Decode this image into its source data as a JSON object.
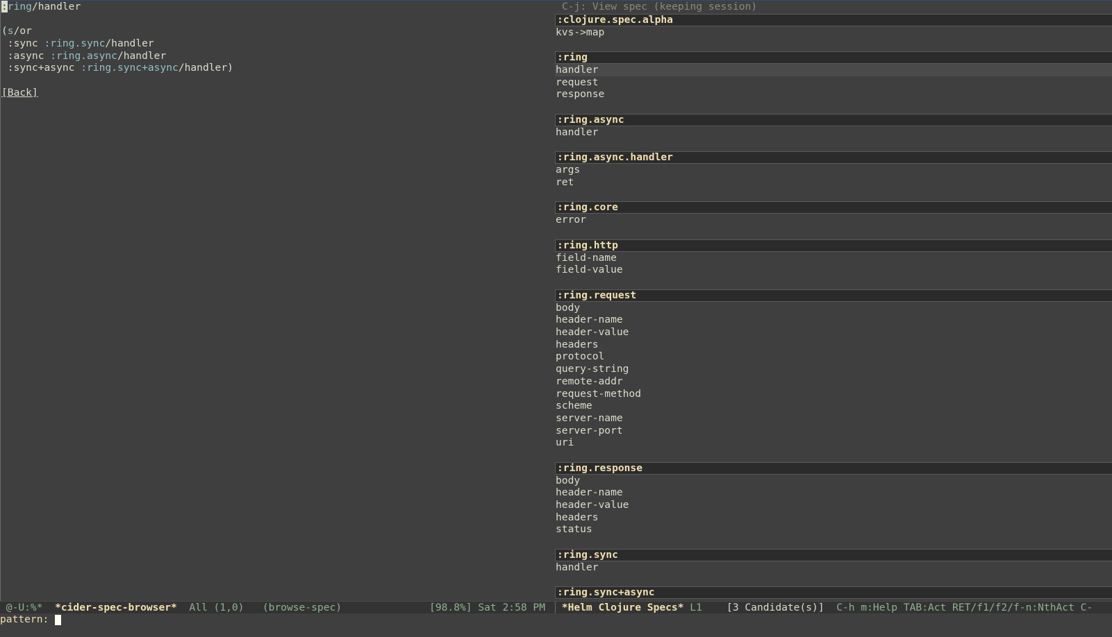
{
  "left": {
    "title_cursor": ":",
    "title_ns": "ring",
    "title_name": "/handler",
    "lines": [
      {
        "open": "(",
        "ns": "s",
        "rest": "/or"
      },
      {
        "key": " :sync ",
        "ns": ":ring.sync",
        "rest": "/handler"
      },
      {
        "key": " :async ",
        "ns": ":ring.async",
        "rest": "/handler"
      },
      {
        "key": " :sync+async ",
        "ns": ":ring.sync+async",
        "rest": "/handler)"
      }
    ],
    "back_label": "[Back]"
  },
  "helm": {
    "hint": "C-j: View spec (keeping session)",
    "groups": [
      {
        "header": ":clojure.spec.alpha",
        "items": [
          "kvs->map"
        ]
      },
      {
        "header": ":ring",
        "items": [
          "handler",
          "request",
          "response"
        ]
      },
      {
        "header": ":ring.async",
        "items": [
          "handler"
        ]
      },
      {
        "header": ":ring.async.handler",
        "items": [
          "args",
          "ret"
        ]
      },
      {
        "header": ":ring.core",
        "items": [
          "error"
        ]
      },
      {
        "header": ":ring.http",
        "items": [
          "field-name",
          "field-value"
        ]
      },
      {
        "header": ":ring.request",
        "items": [
          "body",
          "header-name",
          "header-value",
          "headers",
          "protocol",
          "query-string",
          "remote-addr",
          "request-method",
          "scheme",
          "server-name",
          "server-port",
          "uri"
        ]
      },
      {
        "header": ":ring.response",
        "items": [
          "body",
          "header-name",
          "header-value",
          "headers",
          "status"
        ]
      },
      {
        "header": ":ring.sync",
        "items": [
          "handler"
        ]
      },
      {
        "header": ":ring.sync+async",
        "items": []
      }
    ],
    "selected": "handler"
  },
  "mode_line": {
    "left_status": " @-U:%*  ",
    "left_buffer": "*cider-spec-browser*",
    "left_pos": "  All (1,0)   ",
    "left_mode": "(browse-spec)",
    "left_right": "[98.8%] Sat 2:58 PM",
    "right_buffer": " *Helm Clojure Specs*",
    "right_line": " L1    ",
    "right_candidates": "[3 Candidate(s)]",
    "right_help": "  C-h m:Help TAB:Act RET/f1/f2/f-n:NthAct C-"
  },
  "minibuffer": {
    "prompt": "pattern: "
  }
}
